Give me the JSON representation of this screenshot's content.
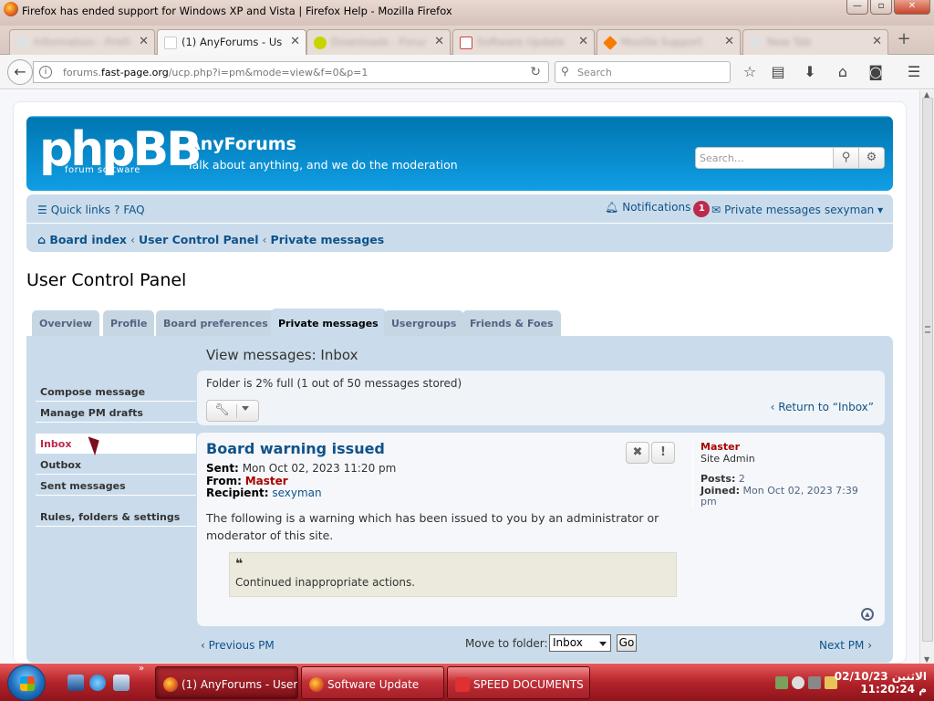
{
  "window": {
    "title": "Firefox has ended support for Windows XP and Vista | Firefox Help - Mozilla Firefox",
    "min": "—",
    "max": "▫",
    "close": "✕"
  },
  "tabs": [
    {
      "label": "Information - Firefox",
      "active": false,
      "icon_color": "#e0e0e0"
    },
    {
      "label": "(1) AnyForums - User C...",
      "active": true,
      "icon_color": "#e0e0e0"
    },
    {
      "label": "Downloads - Forum",
      "active": false,
      "icon_color": "#c8d400"
    },
    {
      "label": "Software Update",
      "active": false,
      "icon_color": "#cc4444"
    },
    {
      "label": "Mozilla Support",
      "active": false,
      "icon_color": "#f57c00"
    },
    {
      "label": "New Tab",
      "active": false,
      "icon_color": "#e0e0e0"
    }
  ],
  "tab_close": "✕",
  "new_tab": "+",
  "nav": {
    "url_host": "forums.",
    "url_domain": "fast-page.org",
    "url_path": "/ucp.php?i=pm&mode=view&f=0&p=1",
    "search_placeholder": "Search"
  },
  "forum": {
    "logo_text": "phpBB",
    "logo_sub": "forum  software",
    "site_name": "AnyForums",
    "site_desc": "Talk about anything, and we do the moderation",
    "search_placeholder": "Search…",
    "quick_links": "Quick links",
    "faq": "FAQ",
    "notifications": "Notifications",
    "notif_count": "1",
    "private_messages": "Private messages",
    "username": "sexyman",
    "breadcrumbs": [
      "Board index",
      "User Control Panel",
      "Private messages"
    ],
    "page_title": "User Control Panel"
  },
  "ucp_tabs": [
    "Overview",
    "Profile",
    "Board preferences",
    "Private messages",
    "Usergroups",
    "Friends & Foes"
  ],
  "menu": {
    "group1": [
      "Compose message",
      "Manage PM drafts"
    ],
    "group2": [
      "Inbox",
      "Outbox",
      "Sent messages"
    ],
    "group3": [
      "Rules, folders & settings"
    ]
  },
  "content": {
    "title": "View messages: Inbox",
    "folder_status": "Folder is 2% full (1 out of 50 messages stored)",
    "return_link": "Return to “Inbox”"
  },
  "message": {
    "subject": "Board warning issued",
    "sent_label": "Sent:",
    "sent_value": "Mon Oct 02, 2023 11:20 pm",
    "from_label": "From:",
    "from_value": "Master",
    "recipient_label": "Recipient:",
    "recipient_value": "sexyman",
    "body": "The following is a warning which has been issued to you by an administrator or moderator of this site.",
    "quote_mark": "❝",
    "quote_text": "Continued inappropriate actions."
  },
  "profile": {
    "username": "Master",
    "rank": "Site Admin",
    "posts_label": "Posts:",
    "posts_value": "2",
    "joined_label": "Joined:",
    "joined_value": "Mon Oct 02, 2023 7:39 pm"
  },
  "bottom": {
    "prev": "Previous PM",
    "move_label": "Move to folder:",
    "move_selected": "Inbox",
    "go": "Go",
    "next": "Next PM"
  },
  "taskbar": {
    "items": [
      {
        "label": "(1) AnyForums - User...",
        "active": true
      },
      {
        "label": "Software Update",
        "active": false
      },
      {
        "label": "SPEED DOCUMENTS",
        "active": false
      }
    ],
    "date": "الاثنين 02/10/23",
    "time": "11:20:24 م"
  }
}
